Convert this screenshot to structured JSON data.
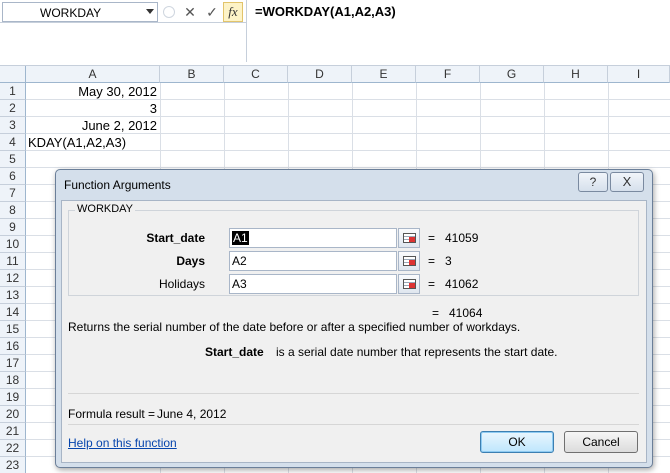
{
  "formula_bar": {
    "name_box": "WORKDAY",
    "cancel_symbol": "✕",
    "enter_symbol": "✓",
    "fx_label": "fx",
    "formula": "=WORKDAY(A1,A2,A3)"
  },
  "grid": {
    "columns": [
      "A",
      "B",
      "C",
      "D",
      "E",
      "F",
      "G",
      "H",
      "I"
    ],
    "rows": [
      "1",
      "2",
      "3",
      "4",
      "5",
      "6",
      "7",
      "8",
      "9",
      "10",
      "11",
      "12",
      "13",
      "14",
      "15",
      "16",
      "17",
      "18",
      "19",
      "20",
      "21",
      "22",
      "23"
    ],
    "cells": {
      "A1": "May 30, 2012",
      "A2": "3",
      "A3": "June 2, 2012",
      "A4": "KDAY(A1,A2,A3)"
    }
  },
  "dialog": {
    "title": "Function Arguments",
    "help_button": "?",
    "close_button": "X",
    "function_name": "WORKDAY",
    "args": [
      {
        "label": "Start_date",
        "value": "A1",
        "result": "41059"
      },
      {
        "label": "Days",
        "value": "A2",
        "result": "3"
      },
      {
        "label": "Holidays",
        "value": "A3",
        "result": "41062"
      }
    ],
    "equals": "=",
    "overall_result": "41064",
    "description": "Returns the serial number of the date before or after a specified number of workdays.",
    "arg_desc_name": "Start_date",
    "arg_desc_text": "is a serial date number that represents the start date.",
    "formula_result_label": "Formula result =",
    "formula_result_value": "June 4, 2012",
    "help_link": "Help on this function",
    "ok_label": "OK",
    "cancel_label": "Cancel"
  }
}
